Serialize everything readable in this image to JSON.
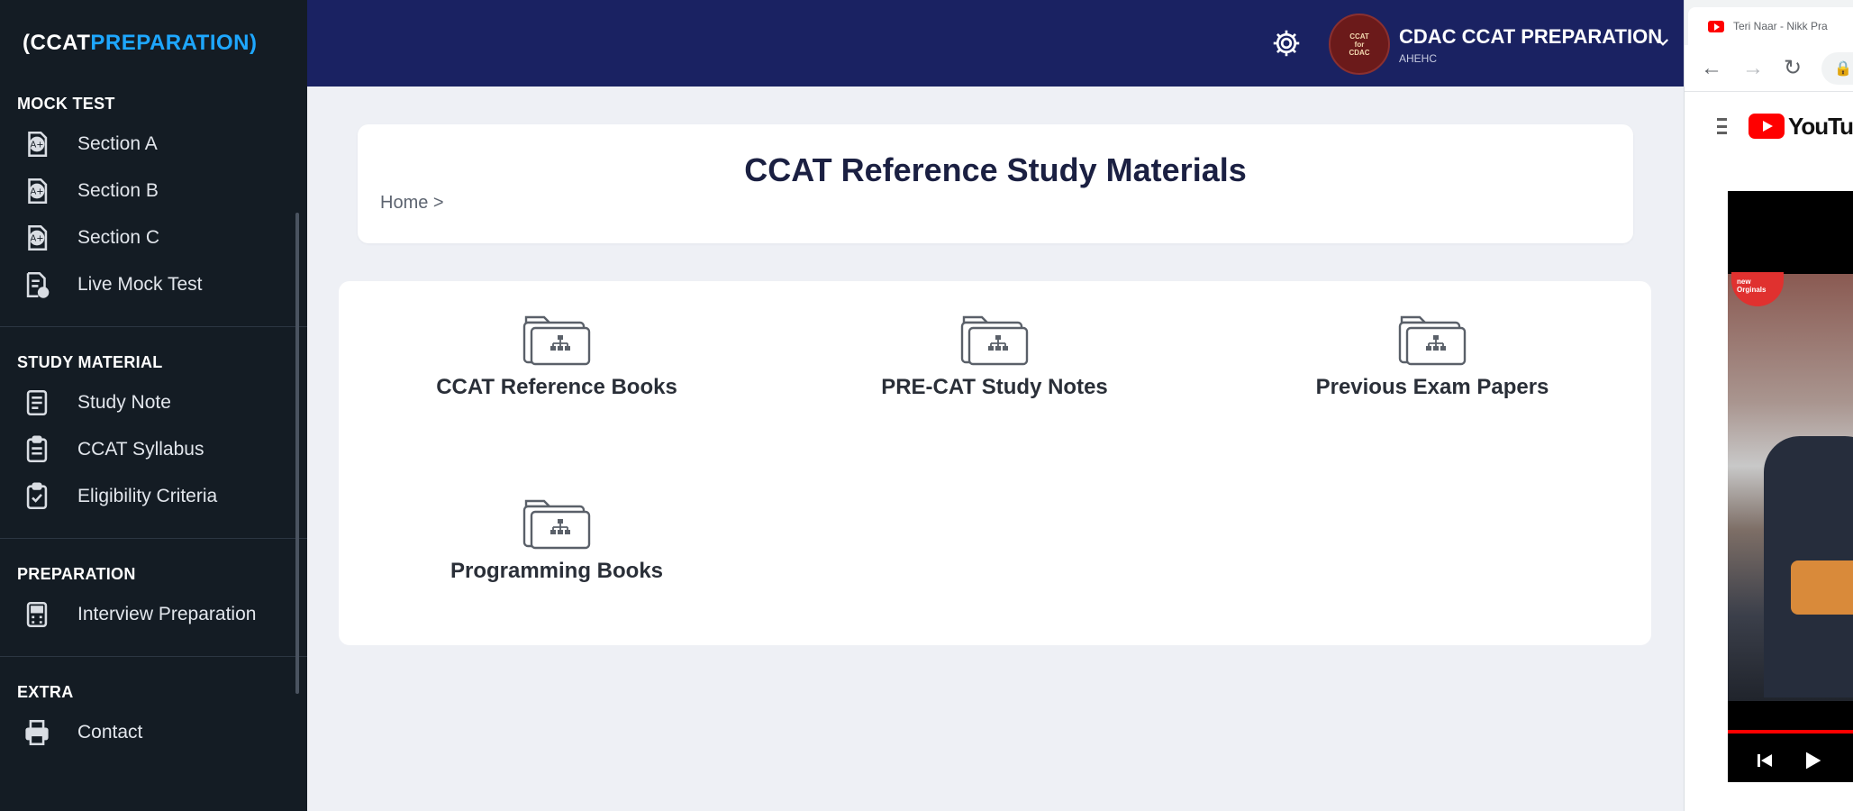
{
  "brand": {
    "open": "(CCAT",
    "accent": "PREPARATION)"
  },
  "sidebar": {
    "sections": [
      {
        "title": "MOCK TEST",
        "items": [
          {
            "label": "Section A",
            "icon": "test-icon"
          },
          {
            "label": "Section B",
            "icon": "test-icon"
          },
          {
            "label": "Section C",
            "icon": "test-icon"
          },
          {
            "label": "Live Mock Test",
            "icon": "live-test-icon"
          }
        ]
      },
      {
        "title": "STUDY MATERIAL",
        "items": [
          {
            "label": "Study Note",
            "icon": "note-icon"
          },
          {
            "label": "CCAT Syllabus",
            "icon": "clipboard-icon"
          },
          {
            "label": "Eligibility Criteria",
            "icon": "checklist-icon"
          }
        ]
      },
      {
        "title": "PREPARATION",
        "items": [
          {
            "label": "Interview Preparation",
            "icon": "calculator-icon"
          }
        ]
      },
      {
        "title": "EXTRA",
        "items": [
          {
            "label": "Contact",
            "icon": "printer-icon"
          }
        ]
      }
    ]
  },
  "topbar": {
    "user_name": "CDAC CCAT PREPARATION",
    "user_sub": "AHEHC",
    "avatar_line1": "CCAT",
    "avatar_line2": "for",
    "avatar_line3": "CDAC"
  },
  "page": {
    "title": "CCAT Reference Study Materials",
    "breadcrumb": "Home >"
  },
  "folders": [
    {
      "label": "CCAT Reference Books"
    },
    {
      "label": "PRE-CAT Study Notes"
    },
    {
      "label": "Previous Exam Papers"
    },
    {
      "label": "Programming Books"
    }
  ],
  "browser": {
    "tab_title": "Teri Naar - Nikk Pra",
    "yt_word": "YouTu",
    "video_badge": "new Orginals"
  },
  "colors": {
    "sidebar_bg": "#141c24",
    "topbar_bg": "#1a2262",
    "brand_accent": "#1ea7ff",
    "page_bg": "#eef0f5",
    "title_color": "#1b2042"
  }
}
